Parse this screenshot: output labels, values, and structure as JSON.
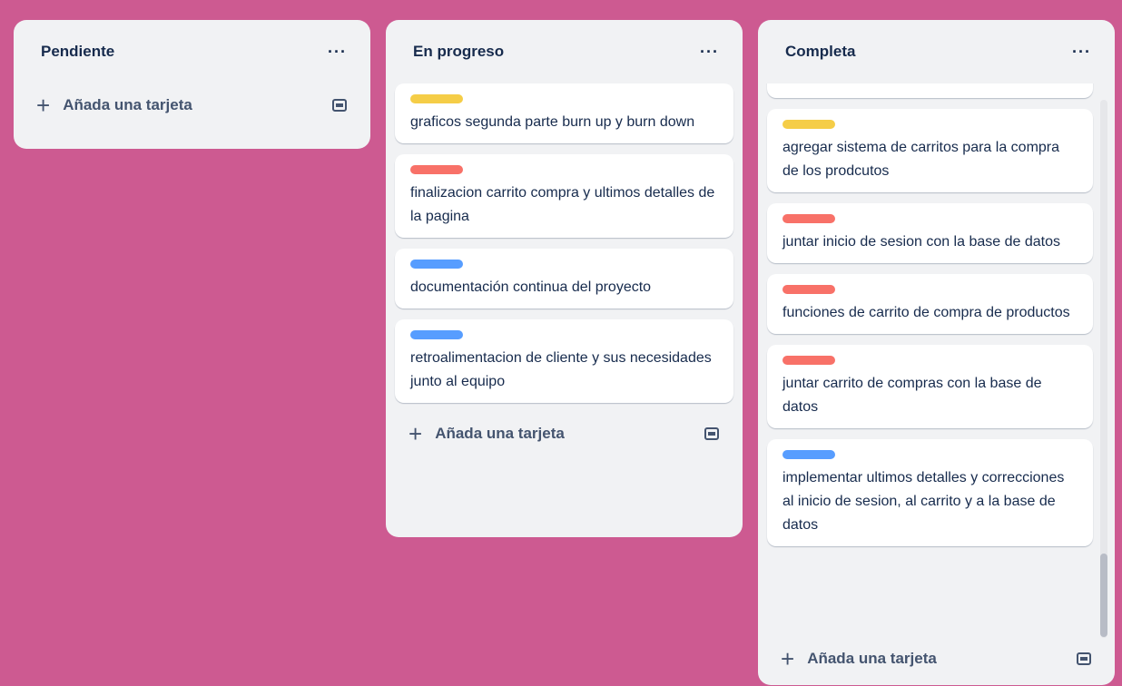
{
  "colors": {
    "background": "#cd5a91",
    "label_yellow": "#f5cd47",
    "label_red": "#f87168",
    "label_blue": "#579dff"
  },
  "icons": {
    "more": "more-dots-icon",
    "add": "plus-icon",
    "template": "card-template-icon"
  },
  "columns": [
    {
      "title": "Pendiente",
      "menu": "···",
      "add_label": "Añada una tarjeta",
      "cards": []
    },
    {
      "title": "En progreso",
      "menu": "···",
      "add_label": "Añada una tarjeta",
      "cards": [
        {
          "label_color": "yellow",
          "text": "graficos segunda parte burn up y burn down"
        },
        {
          "label_color": "red",
          "text": "finalizacion carrito compra y ultimos detalles de la pagina"
        },
        {
          "label_color": "blue",
          "text": "documentación continua del proyecto"
        },
        {
          "label_color": "blue",
          "text": "retroalimentacion de cliente y sus necesidades junto al equipo"
        }
      ]
    },
    {
      "title": "Completa",
      "menu": "···",
      "add_label": "Añada una tarjeta",
      "cards": [
        {
          "label_color": "yellow",
          "text": "agregar sistema de carritos para la compra de los prodcutos"
        },
        {
          "label_color": "red",
          "text": "juntar inicio de sesion con la base de datos"
        },
        {
          "label_color": "red",
          "text": "funciones de carrito de compra de productos"
        },
        {
          "label_color": "red",
          "text": "juntar carrito de compras con la base de datos"
        },
        {
          "label_color": "blue",
          "text": "implementar ultimos detalles y correcciones al inicio de sesion, al carrito y a la base de datos"
        }
      ]
    }
  ]
}
